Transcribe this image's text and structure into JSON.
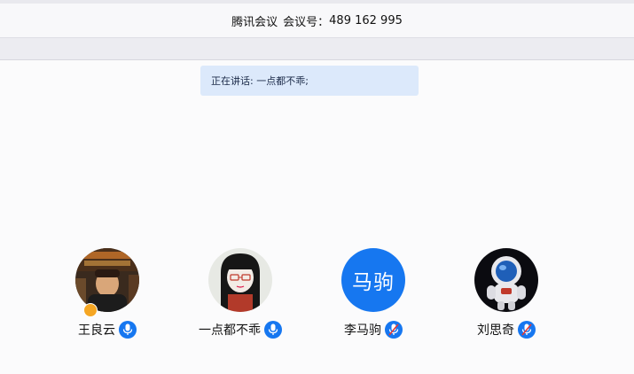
{
  "header": {
    "app_name": "腾讯会议",
    "meeting_id_label": "会议号：",
    "meeting_id": "489 162 995"
  },
  "banner": {
    "speaking_text": "正在讲话: 一点都不乖;"
  },
  "participants": [
    {
      "name": "王良云",
      "avatar": "photo-poster",
      "mic": "on",
      "host_badge": true
    },
    {
      "name": "一点都不乖",
      "avatar": "cartoon-girl",
      "mic": "on",
      "host_badge": false
    },
    {
      "name": "李马驹",
      "avatar_text": "马驹",
      "mic": "muted",
      "host_badge": false
    },
    {
      "name": "刘思奇",
      "avatar": "astronaut",
      "mic": "muted",
      "host_badge": false
    }
  ],
  "colors": {
    "accent": "#1677f0",
    "banner_bg": "#dce9fb",
    "badge": "#f5a623"
  }
}
